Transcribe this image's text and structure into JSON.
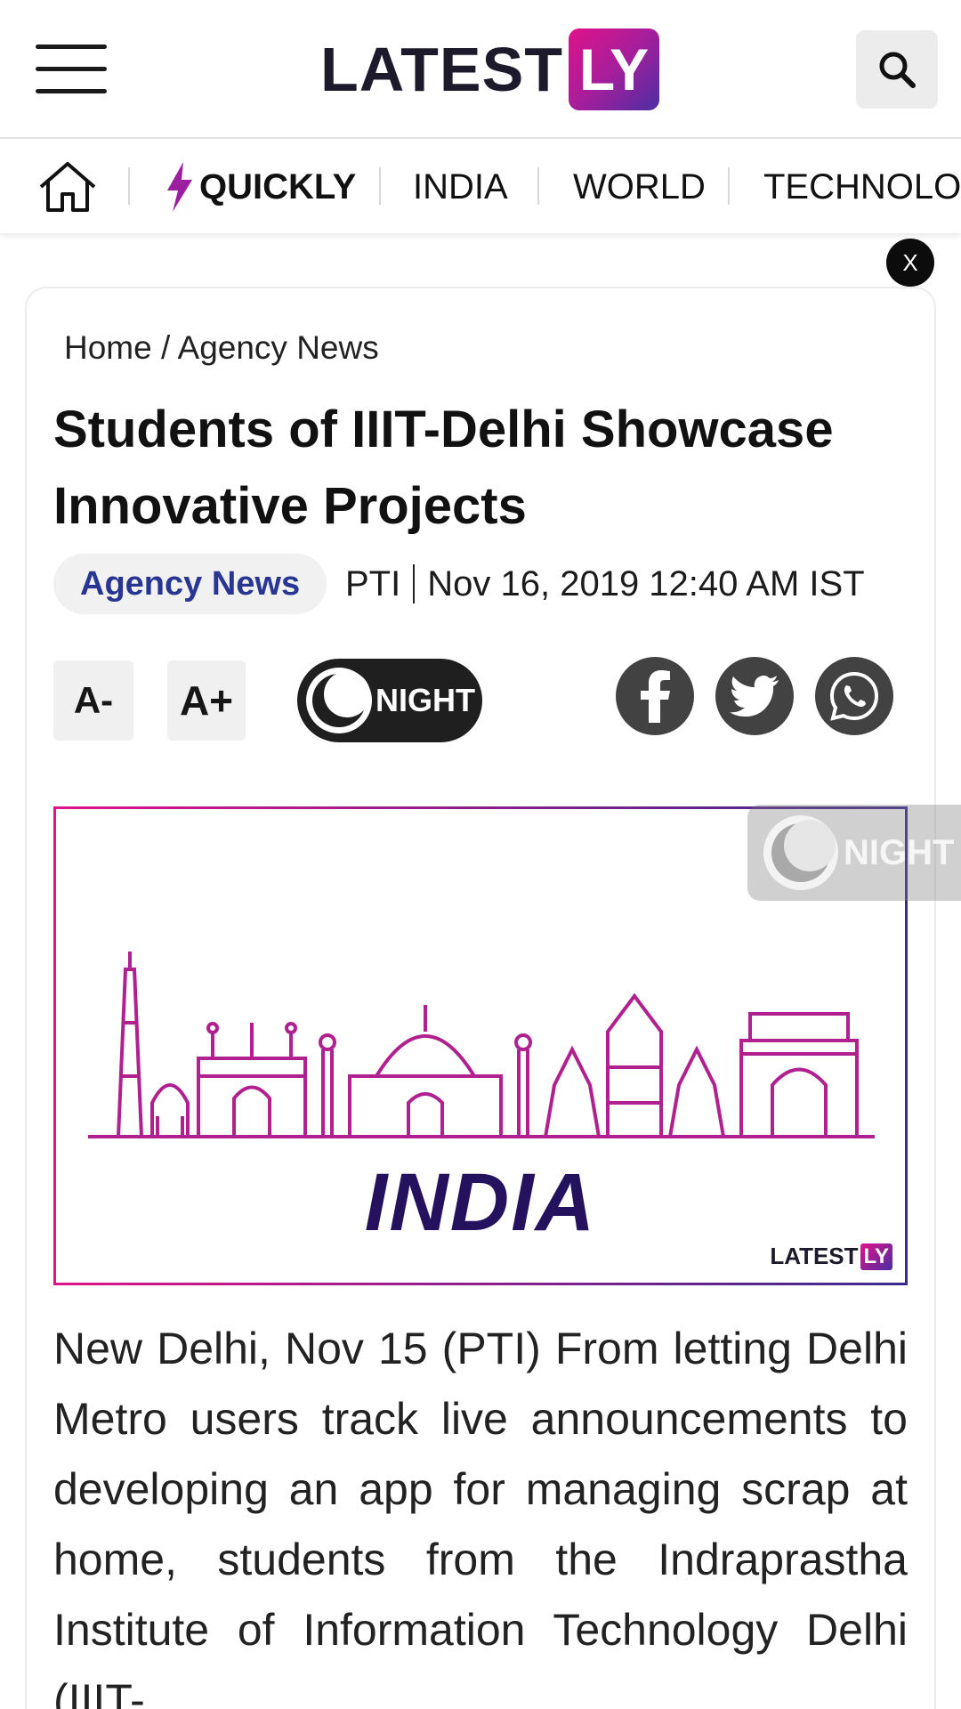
{
  "header": {
    "menu_icon": "hamburger-menu-icon",
    "logo_text": "LATEST",
    "logo_box_text": "LY",
    "search_icon": "search-icon"
  },
  "nav": {
    "home_icon": "home-icon",
    "items": [
      {
        "label": "QUICKLY",
        "icon": "lightning-icon"
      },
      {
        "label": "INDIA"
      },
      {
        "label": "WORLD"
      },
      {
        "label": "TECHNOLOG"
      }
    ]
  },
  "ad_close_label": "X",
  "article": {
    "breadcrumb": {
      "home": "Home",
      "sep": "/",
      "section": "Agency News"
    },
    "title": "Students of IIIT-Delhi Showcase Innovative Projects",
    "category_badge": "Agency News",
    "source": "PTI",
    "timestamp": "Nov 16, 2019 12:40 AM IST",
    "tools": {
      "font_decrease": "A-",
      "font_increase": "A+",
      "night_label": "NIGHT"
    },
    "share": [
      {
        "name": "facebook",
        "icon": "facebook-icon"
      },
      {
        "name": "twitter",
        "icon": "twitter-icon"
      },
      {
        "name": "whatsapp",
        "icon": "whatsapp-icon"
      }
    ],
    "hero": {
      "word": "INDIA",
      "logo_text": "LATEST",
      "logo_box": "LY"
    },
    "floating_night_label": "NIGHT",
    "body": "New Delhi, Nov 15 (PTI) From letting Delhi Metro users track live announcements to developing an app for managing scrap at home, students from the Indraprastha Institute of Information Technology Delhi (IIIT-"
  },
  "colors": {
    "brand_magenta": "#e0128a",
    "brand_purple": "#4b2ea3",
    "badge_text": "#283593",
    "skyline": "#b0208f"
  }
}
